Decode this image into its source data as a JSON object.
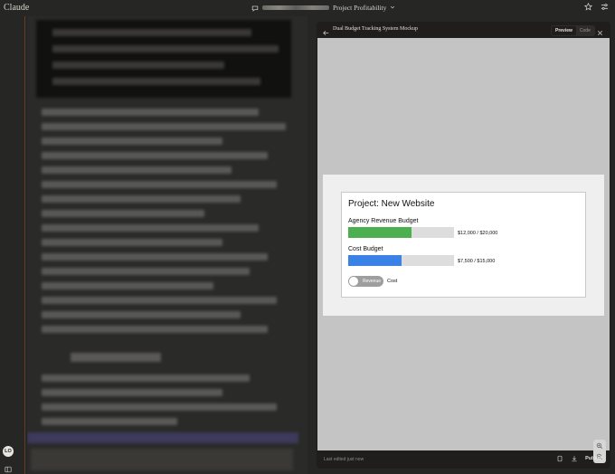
{
  "app": {
    "title": "Claude"
  },
  "header": {
    "project_name": "Project Profitability",
    "icons": [
      "chat-bubble-icon",
      "chevron-down-icon",
      "star-icon",
      "sliders-icon"
    ]
  },
  "user": {
    "initials": "LO"
  },
  "artifact": {
    "title": "Dual Budget Tracking System Mockup",
    "tabs": [
      {
        "label": "Preview",
        "active": true
      },
      {
        "label": "Code",
        "active": false
      }
    ],
    "footer": {
      "last_edited": "Last edited just now",
      "publish_label": "Publish"
    }
  },
  "mockup": {
    "project_title": "Project: New Website",
    "budgets": [
      {
        "label": "Agency Revenue Budget",
        "value_text": "$12,000 / $20,000",
        "fraction": 0.6,
        "color": "#4caf50"
      },
      {
        "label": "Cost Budget",
        "value_text": "$7,500 / $15,000",
        "fraction": 0.5,
        "color": "#3b82e6"
      }
    ],
    "toggle": {
      "left_label": "Revenue",
      "right_label": "Cost"
    }
  },
  "colors": {
    "background": "#262624",
    "panel": "#1f1e1d",
    "accent_line": "#6b3a25"
  }
}
